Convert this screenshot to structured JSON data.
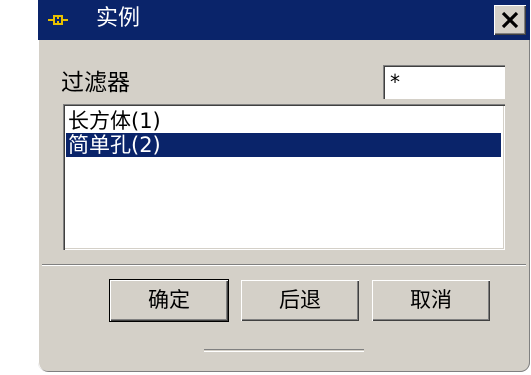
{
  "window": {
    "title": "实例",
    "icon": "mechanism-icon"
  },
  "filter": {
    "label": "过滤器",
    "value": "*"
  },
  "list": {
    "items": [
      {
        "label": "长方体(1)",
        "selected": false
      },
      {
        "label": "简单孔(2)",
        "selected": true
      }
    ]
  },
  "buttons": {
    "ok": "确定",
    "back": "后退",
    "cancel": "取消"
  },
  "colors": {
    "titlebar": "#0a246a",
    "selection": "#0a246a",
    "dialog_bg": "#d4d0c8",
    "icon_accent": "#e8c000"
  }
}
